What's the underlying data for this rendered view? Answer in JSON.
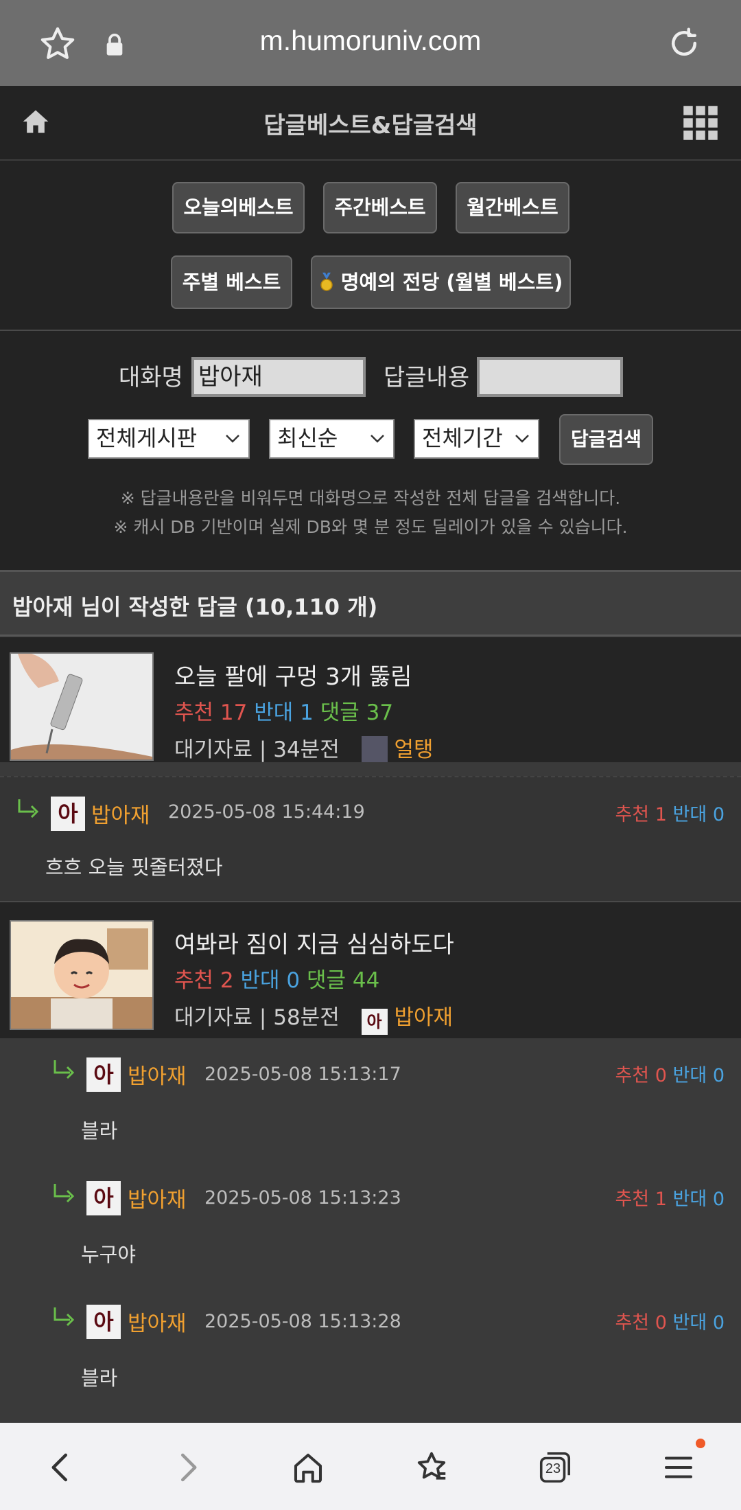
{
  "browser": {
    "url": "m.humoruniv.com",
    "tabs_count": "23"
  },
  "nav": {
    "title": "답글베스트&답글검색"
  },
  "best_buttons": {
    "today": "오늘의베스트",
    "weekly": "주간베스트",
    "monthly": "월간베스트",
    "by_week": "주별 베스트",
    "hall_of_fame": "명예의 전당 (월별 베스트)"
  },
  "search": {
    "nick_label": "대화명",
    "nick_value": "밥아재",
    "content_label": "답글내용",
    "content_value": "",
    "board_select": "전체게시판",
    "sort_select": "최신순",
    "period_select": "전체기간",
    "submit": "답글검색",
    "note1": "※ 답글내용란을 비워두면 대화명으로 작성한 전체 답글을 검색합니다.",
    "note2": "※ 캐시 DB 기반이며 실제 DB와 몇 분 정도 딜레이가 있을 수 있습니다."
  },
  "results_header": "밥아재 님이 작성한 답글 (10,110 개)",
  "posts": [
    {
      "title": "오늘 팔에 구멍 3개 뚫림",
      "rec_label": "추천",
      "rec": "17",
      "opp_label": "반대",
      "opp": "1",
      "cmt_label": "댓글",
      "cmt": "37",
      "meta": "대기자료 | 34분전",
      "author": "얼탱",
      "comments": [
        {
          "avatar": "아",
          "name": "밥아재",
          "date": "2025-05-08 15:44:19",
          "rec_label": "추천",
          "rec": "1",
          "opp_label": "반대",
          "opp": "0",
          "text": "흐흐 오늘 핏줄터졌다"
        }
      ]
    },
    {
      "title": "여봐라 짐이 지금 심심하도다",
      "rec_label": "추천",
      "rec": "2",
      "opp_label": "반대",
      "opp": "0",
      "cmt_label": "댓글",
      "cmt": "44",
      "meta": "대기자료 | 58분전",
      "author_avatar": "아",
      "author": "밥아재",
      "comments": [
        {
          "avatar": "아",
          "name": "밥아재",
          "date": "2025-05-08 15:13:17",
          "rec_label": "추천",
          "rec": "0",
          "opp_label": "반대",
          "opp": "0",
          "text": "블라"
        },
        {
          "avatar": "아",
          "name": "밥아재",
          "date": "2025-05-08 15:13:23",
          "rec_label": "추천",
          "rec": "1",
          "opp_label": "반대",
          "opp": "0",
          "text": "누구야"
        },
        {
          "avatar": "아",
          "name": "밥아재",
          "date": "2025-05-08 15:13:28",
          "rec_label": "추천",
          "rec": "0",
          "opp_label": "반대",
          "opp": "0",
          "text": "블라"
        }
      ]
    }
  ]
}
